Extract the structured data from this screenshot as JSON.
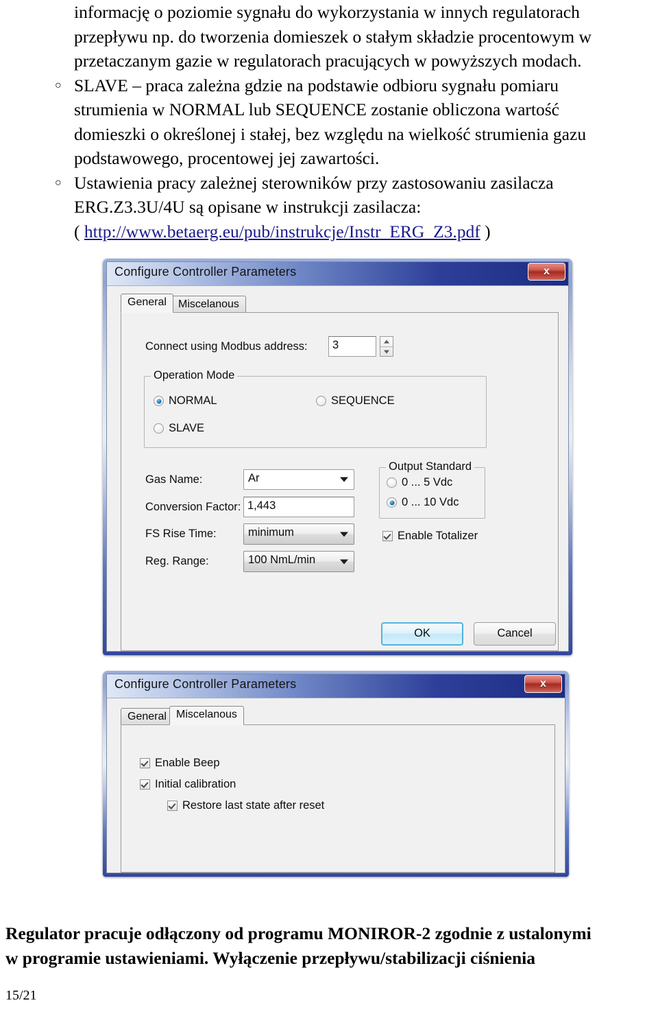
{
  "document": {
    "paragraph_lines": [
      "informację o poziomie sygnału do  wykorzystania w innych regulatorach",
      "przepływu np. do tworzenia domieszek o stałym składzie procentowym w",
      "przetaczanym gazie w regulatorach pracujących w powyższych modach."
    ],
    "bullets": [
      {
        "marker": "○",
        "lines": [
          "SLAVE – praca zależna gdzie na podstawie odbioru sygnału pomiaru",
          "strumienia w NORMAL lub SEQUENCE zostanie obliczona wartość",
          "domieszki o określonej i stałej, bez względu na wielkość strumienia gazu",
          "podstawowego, procentowej jej zawartości."
        ]
      },
      {
        "marker": "○",
        "lines": [
          "Ustawienia pracy zależnej sterowników przy zastosowaniu zasilacza",
          "ERG.Z3.3U/4U są opisane w instrukcji zasilacza:"
        ],
        "link_prefix": "( ",
        "link_text": "http://www.betaerg.eu/pub/instrukcje/Instr_ERG_Z3.pdf",
        "link_suffix": " )"
      }
    ],
    "footer_lines": [
      "Regulator pracuje odłączony od programu MONIROR-2 zgodnie z ustalonymi",
      "w programie ustawieniami. Wyłączenie przepływu/stabilizacji ciśnienia"
    ],
    "page_number": "15/21"
  },
  "dialog_general": {
    "title": "Configure Controller Parameters",
    "close_label": "x",
    "tabs": [
      {
        "label": "General",
        "active": true
      },
      {
        "label": "Miscelanous",
        "active": false
      }
    ],
    "modbus": {
      "label": "Connect using Modbus address:",
      "value": "3"
    },
    "operation_mode": {
      "title": "Operation Mode",
      "options": [
        {
          "label": "NORMAL",
          "checked": true
        },
        {
          "label": "SEQUENCE",
          "checked": false
        },
        {
          "label": "SLAVE",
          "checked": false
        }
      ]
    },
    "fields": [
      {
        "label": "Gas Name:",
        "value": "Ar",
        "kind": "combo-white"
      },
      {
        "label": "Conversion Factor:",
        "value": "1,443",
        "kind": "textbox"
      },
      {
        "label": "FS Rise Time:",
        "value": "minimum",
        "kind": "combo-grey"
      },
      {
        "label": "Reg. Range:",
        "value": "100 NmL/min",
        "kind": "combo-grey"
      }
    ],
    "output_standard": {
      "title": "Output Standard",
      "options": [
        {
          "label": "0 ... 5 Vdc",
          "checked": false
        },
        {
          "label": "0 ... 10 Vdc",
          "checked": true
        }
      ]
    },
    "totalizer": {
      "label": "Enable Totalizer",
      "checked": true
    },
    "buttons": {
      "ok": "OK",
      "cancel": "Cancel"
    }
  },
  "dialog_misc": {
    "title": "Configure Controller Parameters",
    "close_label": "x",
    "tabs": [
      {
        "label": "General",
        "active": false
      },
      {
        "label": "Miscelanous",
        "active": true
      }
    ],
    "checkboxes": [
      {
        "label": "Enable Beep",
        "checked": true
      },
      {
        "label": "Initial calibration",
        "checked": true
      },
      {
        "label": "Restore last state after reset",
        "checked": true
      }
    ]
  },
  "colors": {
    "titlebar_start": "#dfe8f7",
    "titlebar_end": "#1b2c86",
    "close_red": "#a82a20",
    "radio_blue": "#1b79c0",
    "link": "#1a1a8c",
    "default_button_border": "#4fb3e0"
  }
}
